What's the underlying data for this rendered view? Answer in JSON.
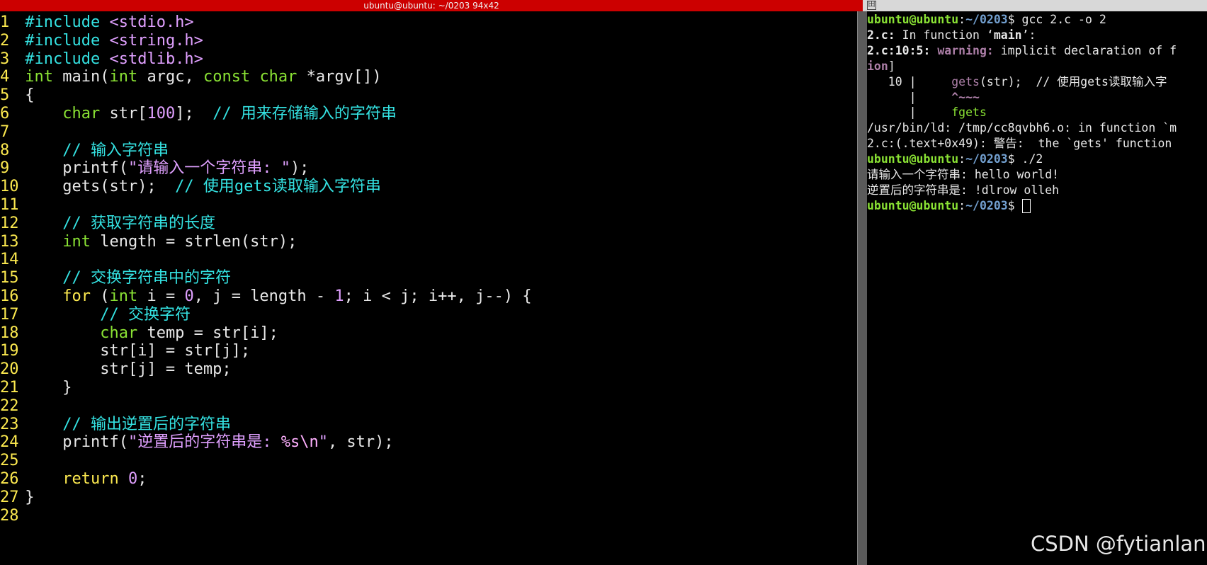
{
  "left_window": {
    "title": "ubuntu@ubuntu: ~/0203 94x42",
    "code_lines": [
      {
        "n": "1",
        "segs": [
          [
            "pp",
            "#include "
          ],
          [
            "inc",
            "<stdio.h>"
          ]
        ]
      },
      {
        "n": "2",
        "segs": [
          [
            "pp",
            "#include "
          ],
          [
            "inc",
            "<string.h>"
          ]
        ]
      },
      {
        "n": "3",
        "segs": [
          [
            "pp",
            "#include "
          ],
          [
            "inc",
            "<stdlib.h>"
          ]
        ]
      },
      {
        "n": "4",
        "segs": [
          [
            "type",
            "int"
          ],
          [
            "plain",
            " main("
          ],
          [
            "type",
            "int"
          ],
          [
            "plain",
            " argc, "
          ],
          [
            "type",
            "const"
          ],
          [
            "plain",
            " "
          ],
          [
            "type",
            "char"
          ],
          [
            "plain",
            " *argv[])"
          ]
        ]
      },
      {
        "n": "5",
        "segs": [
          [
            "plain",
            "{"
          ]
        ]
      },
      {
        "n": "6",
        "segs": [
          [
            "plain",
            "    "
          ],
          [
            "type",
            "char"
          ],
          [
            "plain",
            " str["
          ],
          [
            "num",
            "100"
          ],
          [
            "plain",
            "];  "
          ],
          [
            "cm",
            "// 用来存储输入的字符串"
          ]
        ]
      },
      {
        "n": "7",
        "segs": []
      },
      {
        "n": "8",
        "segs": [
          [
            "plain",
            "    "
          ],
          [
            "cm",
            "// 输入字符串"
          ]
        ]
      },
      {
        "n": "9",
        "segs": [
          [
            "plain",
            "    printf("
          ],
          [
            "str",
            "\"请输入一个字符串: \""
          ],
          [
            "plain",
            ");"
          ]
        ]
      },
      {
        "n": "10",
        "segs": [
          [
            "plain",
            "    gets(str);  "
          ],
          [
            "cm",
            "// 使用gets读取输入字符串"
          ]
        ]
      },
      {
        "n": "11",
        "segs": []
      },
      {
        "n": "12",
        "segs": [
          [
            "plain",
            "    "
          ],
          [
            "cm",
            "// 获取字符串的长度"
          ]
        ]
      },
      {
        "n": "13",
        "segs": [
          [
            "plain",
            "    "
          ],
          [
            "type",
            "int"
          ],
          [
            "plain",
            " length = strlen(str);"
          ]
        ]
      },
      {
        "n": "14",
        "segs": []
      },
      {
        "n": "15",
        "segs": [
          [
            "plain",
            "    "
          ],
          [
            "cm",
            "// 交换字符串中的字符"
          ]
        ]
      },
      {
        "n": "16",
        "segs": [
          [
            "plain",
            "    "
          ],
          [
            "kw",
            "for"
          ],
          [
            "plain",
            " ("
          ],
          [
            "type",
            "int"
          ],
          [
            "plain",
            " i = "
          ],
          [
            "num",
            "0"
          ],
          [
            "plain",
            ", j = length - "
          ],
          [
            "num",
            "1"
          ],
          [
            "plain",
            "; i < j; i++, j--) {"
          ]
        ]
      },
      {
        "n": "17",
        "segs": [
          [
            "plain",
            "        "
          ],
          [
            "cm",
            "// 交换字符"
          ]
        ]
      },
      {
        "n": "18",
        "segs": [
          [
            "plain",
            "        "
          ],
          [
            "type",
            "char"
          ],
          [
            "plain",
            " temp = str[i];"
          ]
        ]
      },
      {
        "n": "19",
        "segs": [
          [
            "plain",
            "        str[i] = str[j];"
          ]
        ]
      },
      {
        "n": "20",
        "segs": [
          [
            "plain",
            "        str[j] = temp;"
          ]
        ]
      },
      {
        "n": "21",
        "segs": [
          [
            "plain",
            "    }"
          ]
        ]
      },
      {
        "n": "22",
        "segs": []
      },
      {
        "n": "23",
        "segs": [
          [
            "plain",
            "    "
          ],
          [
            "cm",
            "// 输出逆置后的字符串"
          ]
        ]
      },
      {
        "n": "24",
        "segs": [
          [
            "plain",
            "    printf("
          ],
          [
            "str",
            "\"逆置后的字符串是: "
          ],
          [
            "esc",
            "%s\\n"
          ],
          [
            "str",
            "\""
          ],
          [
            "plain",
            ", str);"
          ]
        ]
      },
      {
        "n": "25",
        "segs": []
      },
      {
        "n": "26",
        "segs": [
          [
            "plain",
            "    "
          ],
          [
            "kw",
            "return"
          ],
          [
            "plain",
            " "
          ],
          [
            "num",
            "0"
          ],
          [
            "plain",
            ";"
          ]
        ]
      },
      {
        "n": "27",
        "segs": [
          [
            "plain",
            "}"
          ]
        ]
      },
      {
        "n": "28",
        "segs": []
      }
    ]
  },
  "right_window": {
    "icon": "terminal-split-icon",
    "lines": [
      [
        [
          "user",
          "ubuntu@ubuntu"
        ],
        [
          "plain",
          ":"
        ],
        [
          "path",
          "~/0203"
        ],
        [
          "plain",
          "$ gcc 2.c -o 2"
        ]
      ],
      [
        [
          "bold",
          "2.c:"
        ],
        [
          "plain",
          " In function ‘"
        ],
        [
          "bold",
          "main"
        ],
        [
          "plain",
          "’:"
        ]
      ],
      [
        [
          "bold",
          "2.c:10:5: "
        ],
        [
          "warn",
          "warning: "
        ],
        [
          "plain",
          "implicit declaration of f"
        ]
      ],
      [
        [
          "warn",
          "ion"
        ],
        [
          "plain",
          "]"
        ]
      ],
      [
        [
          "plain",
          "   10 |     "
        ],
        [
          "purple",
          "gets"
        ],
        [
          "plain",
          "(str);  // 使用gets读取输入字"
        ]
      ],
      [
        [
          "plain",
          "      |     "
        ],
        [
          "warn",
          "^~~~"
        ]
      ],
      [
        [
          "plain",
          "      |     "
        ],
        [
          "green",
          "fgets"
        ]
      ],
      [
        [
          "plain",
          "/usr/bin/ld: /tmp/cc8qvbh6.o: in function `m"
        ]
      ],
      [
        [
          "plain",
          "2.c:(.text+0x49): 警告:  the `gets' function"
        ]
      ],
      [
        [
          "user",
          "ubuntu@ubuntu"
        ],
        [
          "plain",
          ":"
        ],
        [
          "path",
          "~/0203"
        ],
        [
          "plain",
          "$ ./2"
        ]
      ],
      [
        [
          "plain",
          "请输入一个字符串: hello world!"
        ]
      ],
      [
        [
          "plain",
          "逆置后的字符串是: !dlrow olleh"
        ]
      ],
      [
        [
          "user",
          "ubuntu@ubuntu"
        ],
        [
          "plain",
          ":"
        ],
        [
          "path",
          "~/0203"
        ],
        [
          "plain",
          "$ "
        ]
      ]
    ]
  },
  "watermark": "CSDN @fytianlan"
}
